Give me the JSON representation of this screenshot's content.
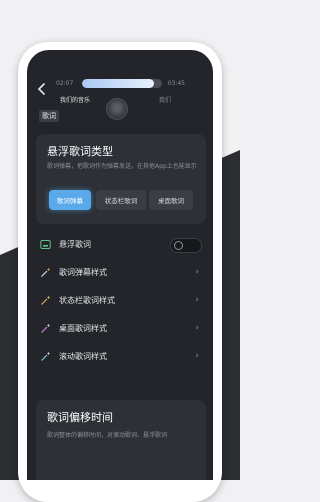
{
  "player": {
    "time_left": "02:07",
    "time_right": "03:45",
    "progress": 0.9,
    "left_label": "我们的音乐",
    "right_label": "我们"
  },
  "section_tag": "歌词",
  "floating_type": {
    "title": "悬浮歌词类型",
    "description": "歌词弹幕，把歌词作为弹幕发送，在其他App上也能显示",
    "options": [
      "歌词弹幕",
      "状态栏歌词",
      "桌面歌词"
    ],
    "selected": "歌词弹幕"
  },
  "settings": {
    "items": [
      {
        "label": "悬浮歌词",
        "icon": "floating-lyrics-icon",
        "type": "toggle",
        "on": false
      },
      {
        "label": "歌词弹幕样式",
        "icon": "magic-wand-icon",
        "type": "link"
      },
      {
        "label": "状态栏歌词样式",
        "icon": "magic-wand-icon",
        "type": "link"
      },
      {
        "label": "桌面歌词样式",
        "icon": "magic-wand-icon",
        "type": "link"
      },
      {
        "label": "滚动歌词样式",
        "icon": "magic-wand-icon",
        "type": "link"
      }
    ]
  },
  "offset": {
    "title": "歌词偏移时间",
    "description": "歌词整体的偏移时间，对滚动歌词、悬浮歌词"
  },
  "colors": {
    "accent": "#5aa9ea",
    "toggle_icon": "#5fc08a"
  }
}
